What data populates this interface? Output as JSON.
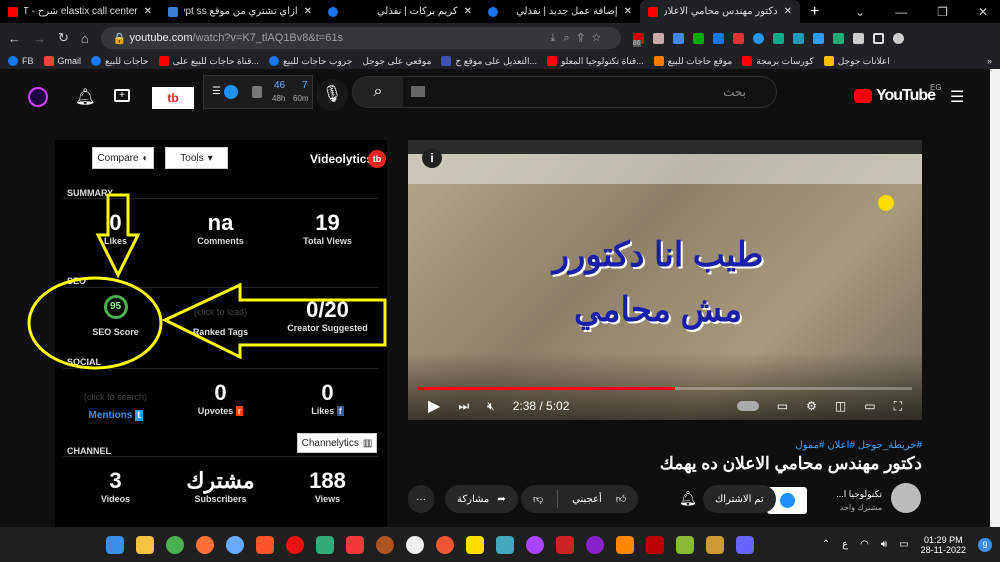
{
  "browser": {
    "tabs": [
      {
        "title": "elastix call center شرح - YouT",
        "active": false
      },
      {
        "title": "ازاي تشتري من موقع Egypt ss",
        "active": false
      },
      {
        "title": "كريم بركات | نفذلي",
        "active": false
      },
      {
        "title": "إضافة عمل جديد | نفذلي",
        "active": false
      },
      {
        "title": "دكتور مهندس محامي الاعلان د",
        "active": true
      }
    ],
    "new_tab": "+",
    "url_host": "youtube.com",
    "url_path": "/watch?v=K7_tlAQ1Bv8&t=61s",
    "ext_badge": "86",
    "bookmarks": [
      "FB",
      "Gmail",
      "حاجات للبيع",
      "قناة حاجات للبيع على...",
      "جروب حاجات للبيع",
      "موقعي على جوجل",
      "التعديل على موقع ج...",
      "قناة تكنولوجيا المعلو...",
      "موقع حاجات للبيع",
      "كورسات برمجة",
      "اعلانات جوجل"
    ],
    "more": "»"
  },
  "youtube": {
    "search_placeholder": "بحث",
    "country": "EG",
    "logo": "YouTube",
    "vidiq": {
      "a": "46",
      "a_sub": "48h",
      "b": "7",
      "b_sub": "60m"
    }
  },
  "panel": {
    "compare": "Compare",
    "tools": "Tools",
    "brand": "Videolytics",
    "summary": "SUMMARY",
    "likes": {
      "value": "0",
      "label": "Likes"
    },
    "comments": {
      "value": "na",
      "label": "Comments"
    },
    "views": {
      "value": "19",
      "label": "Total Views"
    },
    "seo": "SEO",
    "seo_score": {
      "value": "95",
      "label": "SEO Score"
    },
    "ranked": {
      "hint": "(click to load)",
      "label": "Ranked Tags"
    },
    "creator": {
      "value": "0/20",
      "label": "Creator Suggested"
    },
    "social": "SOCIAL",
    "mentions": {
      "hint": "(click to search)",
      "label": "Mentions"
    },
    "upvotes": {
      "value": "0",
      "label": "Upvotes"
    },
    "fb_likes": {
      "value": "0",
      "label": "Likes"
    },
    "channel": "CHANNEL",
    "channelytics": "Channelytics",
    "videos": {
      "value": "3",
      "label": "Videos"
    },
    "subs": {
      "value": "مشترك",
      "label": "Subscribers"
    },
    "ch_views": {
      "value": "188",
      "label": "Views"
    }
  },
  "video": {
    "overlay_line1": "طيب انا دكتورر",
    "overlay_line2": "مش محامي",
    "time": "2:38 / 5:02",
    "progress": 0.52,
    "hashtags": "#خريطة_جوجل #اعلان #ممول",
    "title": "دكتور مهندس محامي الاعلان ده يهمك",
    "channel_name": "تكنولوجيا ا...",
    "channel_subs": "مشترك واحد",
    "subscribed": "تم الاشتراك",
    "like": "أعجبني",
    "share": "مشاركة",
    "more": "···"
  },
  "taskbar": {
    "lang": "ع",
    "time": "01:29 PM",
    "date": "28-11-2022",
    "notif": "9"
  }
}
